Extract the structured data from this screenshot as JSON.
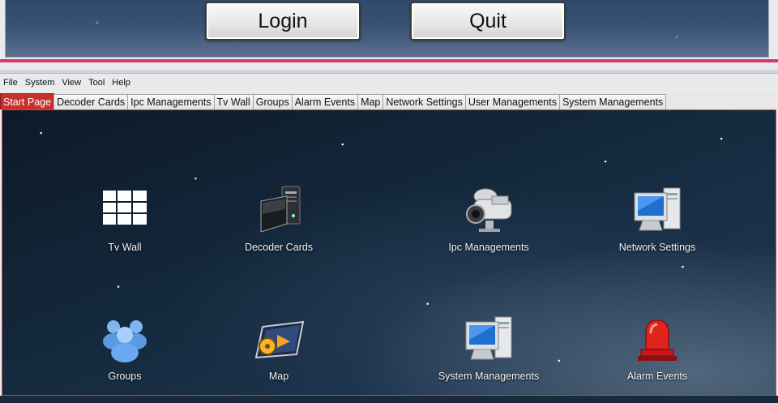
{
  "login_window": {
    "login_label": "Login",
    "quit_label": "Quit"
  },
  "menubar": {
    "items": [
      "File",
      "System",
      "View",
      "Tool",
      "Help"
    ]
  },
  "tabs": [
    "Start Page",
    "Decoder Cards",
    "Ipc Managements",
    "Tv Wall",
    "Groups",
    "Alarm Events",
    "Map",
    "Network Settings",
    "User Managements",
    "System Managements"
  ],
  "active_tab": "Start Page",
  "start_page": {
    "tiles": [
      {
        "label": "Tv Wall",
        "icon": "tv-wall-grid-icon"
      },
      {
        "label": "Decoder Cards",
        "icon": "decoder-card-icon"
      },
      {
        "label": "Ipc Managements",
        "icon": "camera-icon"
      },
      {
        "label": "Network Settings",
        "icon": "network-computer-icon"
      },
      {
        "label": "Groups",
        "icon": "user-group-icon"
      },
      {
        "label": "Map",
        "icon": "map-icon"
      },
      {
        "label": "System Managements",
        "icon": "system-computer-icon"
      },
      {
        "label": "Alarm Events",
        "icon": "alarm-siren-icon"
      }
    ]
  },
  "colors": {
    "active_tab": "#c9302c",
    "divider": "#d23b6f",
    "content_bg": "#13273a"
  }
}
